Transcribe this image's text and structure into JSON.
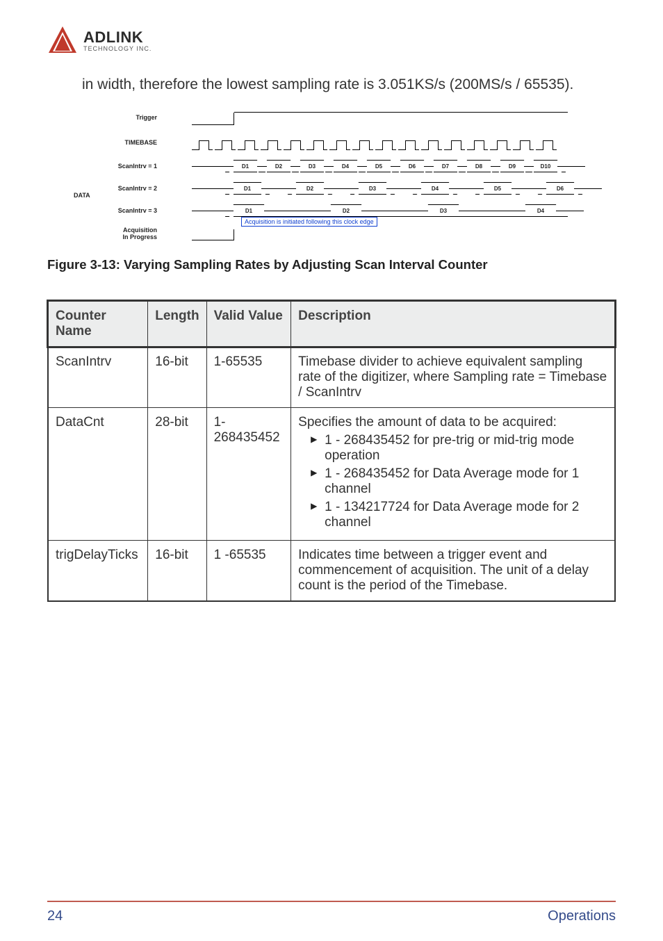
{
  "logo": {
    "brand": "ADLINK",
    "sub": "TECHNOLOGY INC."
  },
  "paragraph": "in width, therefore the lowest sampling rate is 3.051KS/s (200MS/s / 65535).",
  "diagram": {
    "labels": {
      "trigger": "Trigger",
      "timebase": "TIMEBASE",
      "scan1": "ScanIntrv = 1",
      "scan2": "ScanIntrv = 2",
      "scan3": "ScanIntrv = 3",
      "data": "DATA",
      "acq": "Acquisition\nIn Progress"
    },
    "scan1_data": [
      "D1",
      "D2",
      "D3",
      "D4",
      "D5",
      "D6",
      "D7",
      "D8",
      "D9",
      "D10"
    ],
    "scan2_data": [
      "D1",
      "D2",
      "D3",
      "D4",
      "D5",
      "D6"
    ],
    "scan3_data": [
      "D1",
      "D2",
      "D3",
      "D4"
    ],
    "note": "Acquisition is initiated following this clock edge",
    "tick_count": 16
  },
  "figure_caption": "Figure 3-13: Varying Sampling Rates by Adjusting Scan Interval Counter",
  "table": {
    "headers": [
      "Counter Name",
      "Length",
      "Valid Value",
      "Description"
    ],
    "rows": [
      {
        "name": "ScanIntrv",
        "length": "16-bit",
        "valid": "1-65535",
        "desc": "Timebase divider to achieve equivalent sampling rate of the digitizer, where Sampling rate = Timebase / ScanIntrv",
        "bullets": []
      },
      {
        "name": "DataCnt",
        "length": "28-bit",
        "valid": "1-268435452",
        "desc": "Specifies the amount of data to be acquired:",
        "bullets": [
          "1 - 268435452 for pre-trig or mid-trig mode operation",
          "1 - 268435452 for Data Average mode for 1 channel",
          "1 - 134217724 for Data Average mode for 2 channel"
        ]
      },
      {
        "name": "trigDelayTicks",
        "length": "16-bit",
        "valid": "1 -65535",
        "desc": "Indicates time between a trigger event and commencement of acquisition. The unit of a delay count is the period of the Timebase.",
        "bullets": []
      }
    ]
  },
  "footer": {
    "page": "24",
    "section": "Operations"
  }
}
